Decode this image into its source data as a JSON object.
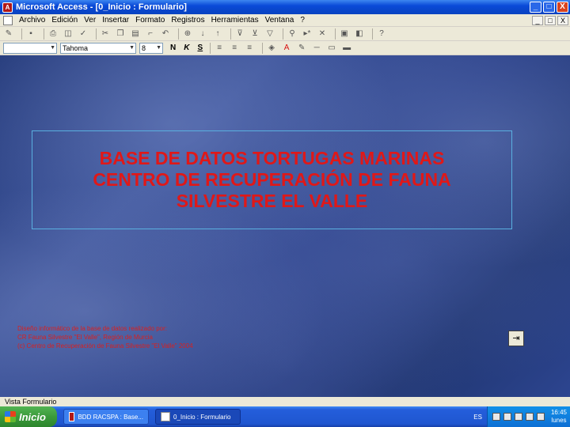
{
  "window": {
    "title": "Microsoft Access - [0_Inicio : Formulario]",
    "minimize": "_",
    "maximize": "□",
    "close": "X"
  },
  "menubar": {
    "items": [
      "Archivo",
      "Edición",
      "Ver",
      "Insertar",
      "Formato",
      "Registros",
      "Herramientas",
      "Ventana",
      "?"
    ]
  },
  "format_toolbar": {
    "object_combo": "",
    "font_combo": "Tahoma",
    "size_combo": "8",
    "bold": "N",
    "italic": "K",
    "underline": "S"
  },
  "form": {
    "title_lines": [
      "BASE DE DATOS TORTUGAS MARINAS",
      "CENTRO DE RECUPERACIÓN DE FAUNA",
      "SILVESTRE EL VALLE"
    ],
    "credits": [
      "Diseño informático de la base de datos realizado por:",
      "CR Fauna Silvestre \"El Valle\", Región de Murcia",
      "(c) Centro de Recuperación de Fauna Silvestre \"El Valle\" 2004"
    ],
    "exit_icon": "exit-door-icon"
  },
  "statusbar": {
    "text": "Vista Formulario"
  },
  "taskbar": {
    "start_label": "Inicio",
    "items": [
      "BDD RACSPA : Base...",
      "0_Inicio : Formulario"
    ],
    "language": "ES",
    "clock_time": "16:45",
    "clock_day": "lunes"
  },
  "colors": {
    "title_text": "#e01818",
    "title_border": "#5ab0e0",
    "xp_blue": "#0a4ad8"
  }
}
